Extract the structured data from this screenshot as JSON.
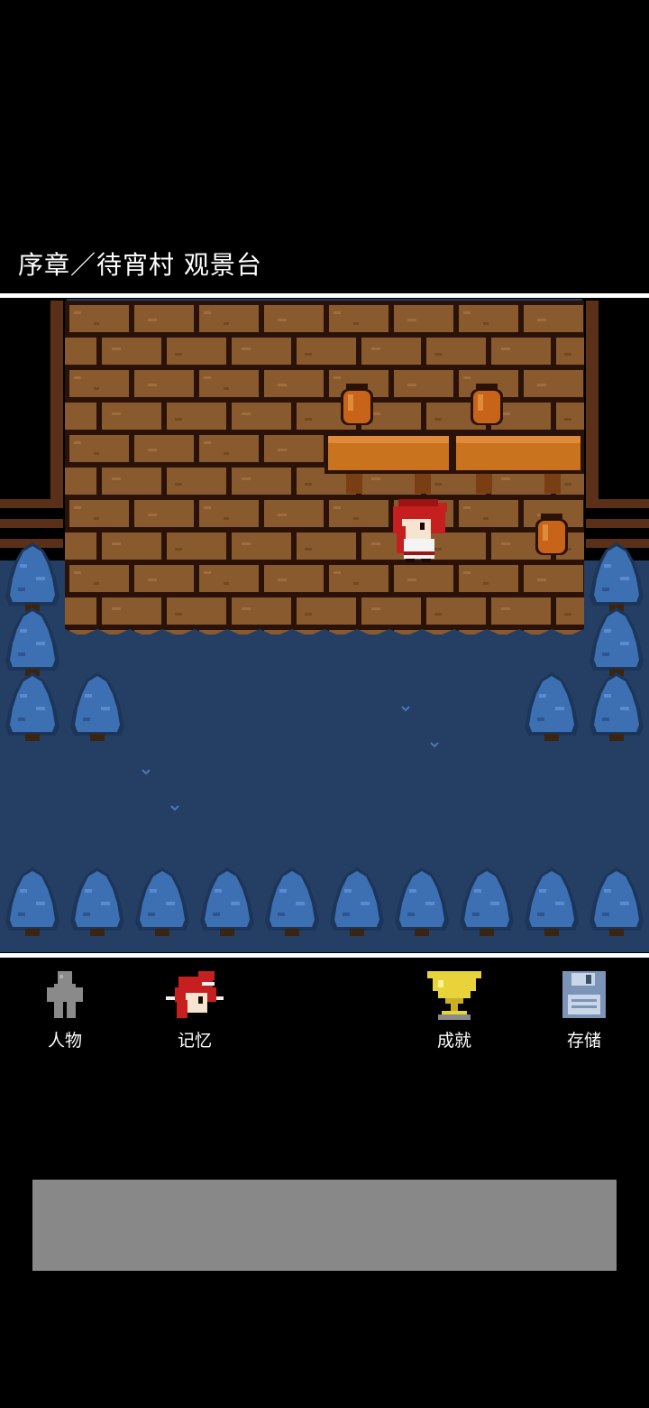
{
  "header": {
    "location": "序章／待宵村 观景台"
  },
  "menu": {
    "items": [
      {
        "id": "characters",
        "label": "人物",
        "icon": "person-silhouette-icon"
      },
      {
        "id": "memories",
        "label": "记忆",
        "icon": "red-hair-portrait-icon"
      },
      {
        "id": "achievements",
        "label": "成就",
        "icon": "gold-trophy-icon"
      },
      {
        "id": "save",
        "label": "存储",
        "icon": "floppy-disk-icon"
      }
    ]
  },
  "message_box": {
    "text": ""
  },
  "colors": {
    "background": "#000000",
    "divider": "#ffffff",
    "ground": "#243f63",
    "brick": "#8a5a2f",
    "tree": "#3d6fb3",
    "trophy": "#e8d33a",
    "floppy": "#7b94b8",
    "message_box": "#888888"
  }
}
